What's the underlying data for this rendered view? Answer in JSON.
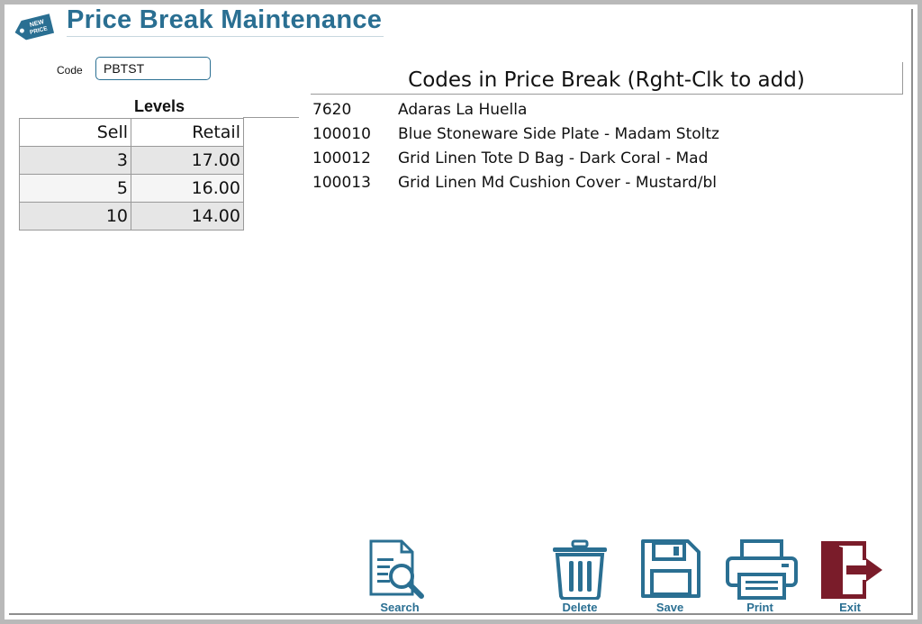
{
  "window": {
    "title": "Price Break Maintenance",
    "logo_text_line1": "NEW",
    "logo_text_line2": "PRICE"
  },
  "code_field": {
    "label": "Code",
    "value": "PBTST"
  },
  "levels": {
    "title": "Levels",
    "headers": {
      "sell": "Sell",
      "retail": "Retail"
    },
    "rows": [
      {
        "sell": "3",
        "retail": "17.00"
      },
      {
        "sell": "5",
        "retail": "16.00"
      },
      {
        "sell": "10",
        "retail": "14.00"
      }
    ]
  },
  "codes": {
    "header": "Codes in Price Break (Rght-Clk to add)",
    "rows": [
      {
        "code": "7620",
        "description": "Adaras La Huella"
      },
      {
        "code": "100010",
        "description": "Blue Stoneware Side Plate - Madam Stoltz"
      },
      {
        "code": "100012",
        "description": "Grid Linen Tote D Bag - Dark Coral - Mad"
      },
      {
        "code": "100013",
        "description": "Grid Linen Md Cushion Cover - Mustard/bl"
      }
    ]
  },
  "toolbar": {
    "search_label": "Search",
    "delete_label": "Delete",
    "save_label": "Save",
    "print_label": "Print",
    "exit_label": "Exit",
    "icons": {
      "search": "search-document-icon",
      "delete": "trash-icon",
      "save": "floppy-disk-icon",
      "print": "printer-icon",
      "exit": "exit-door-icon"
    }
  },
  "colors": {
    "accent": "#2a6f92",
    "exit": "#7a1c2a",
    "row_shade": "#e6e6e6"
  }
}
